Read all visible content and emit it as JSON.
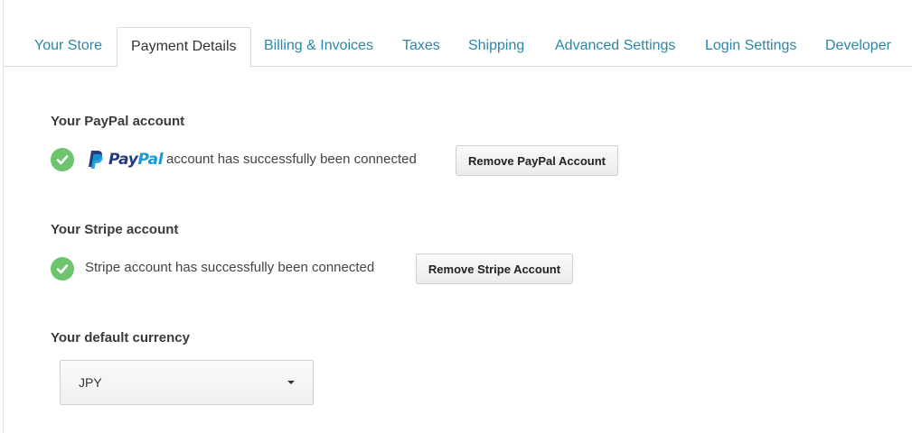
{
  "tabs": [
    {
      "label": "Your Store",
      "active": false
    },
    {
      "label": "Payment Details",
      "active": true
    },
    {
      "label": "Billing & Invoices",
      "active": false
    },
    {
      "label": "Taxes",
      "active": false
    },
    {
      "label": "Shipping",
      "active": false
    },
    {
      "label": "Advanced Settings",
      "active": false
    },
    {
      "label": "Login Settings",
      "active": false
    },
    {
      "label": "Developer",
      "active": false
    }
  ],
  "paypal": {
    "section_title": "Your PayPal account",
    "logo_pay": "Pay",
    "logo_pal": "Pal",
    "status_text": "account has successfully been connected",
    "remove_label": "Remove PayPal Account"
  },
  "stripe": {
    "section_title": "Your Stripe account",
    "status_text": "Stripe account has successfully been connected",
    "remove_label": "Remove Stripe Account"
  },
  "currency": {
    "section_title": "Your default currency",
    "selected": "JPY"
  },
  "colors": {
    "tab_link": "#2a87a7",
    "success_green": "#6cc56c",
    "paypal_dark": "#253b80",
    "paypal_light": "#179bd7"
  },
  "icons": {
    "success": "check-circle-icon",
    "dropdown": "caret-down-icon",
    "paypal": "paypal-logo-icon"
  }
}
